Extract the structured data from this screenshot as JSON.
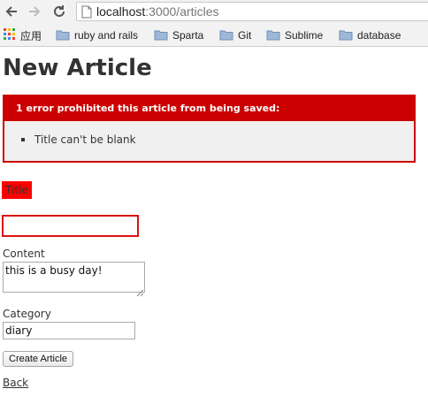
{
  "browser": {
    "url_host": "localhost",
    "url_path": ":3000/articles",
    "bookmarks": [
      {
        "label": "应用",
        "icon": "apps-grid-icon"
      },
      {
        "label": "ruby and rails",
        "icon": "folder-icon"
      },
      {
        "label": "Sparta",
        "icon": "folder-icon"
      },
      {
        "label": "Git",
        "icon": "folder-icon"
      },
      {
        "label": "Sublime",
        "icon": "folder-icon"
      },
      {
        "label": "database",
        "icon": "folder-icon"
      }
    ]
  },
  "page": {
    "title": "New Article",
    "error": {
      "header": "1 error prohibited this article from being saved:",
      "messages": [
        "Title can't be blank"
      ]
    },
    "form": {
      "title_label": "Title",
      "title_value": "",
      "content_label": "Content",
      "content_value": "this is a busy day!",
      "category_label": "Category",
      "category_value": "diary",
      "submit_label": "Create Article"
    },
    "back_link": "Back"
  },
  "colors": {
    "error_red": "#cc0000",
    "field_error_red": "#ff0000",
    "text": "#333333"
  }
}
